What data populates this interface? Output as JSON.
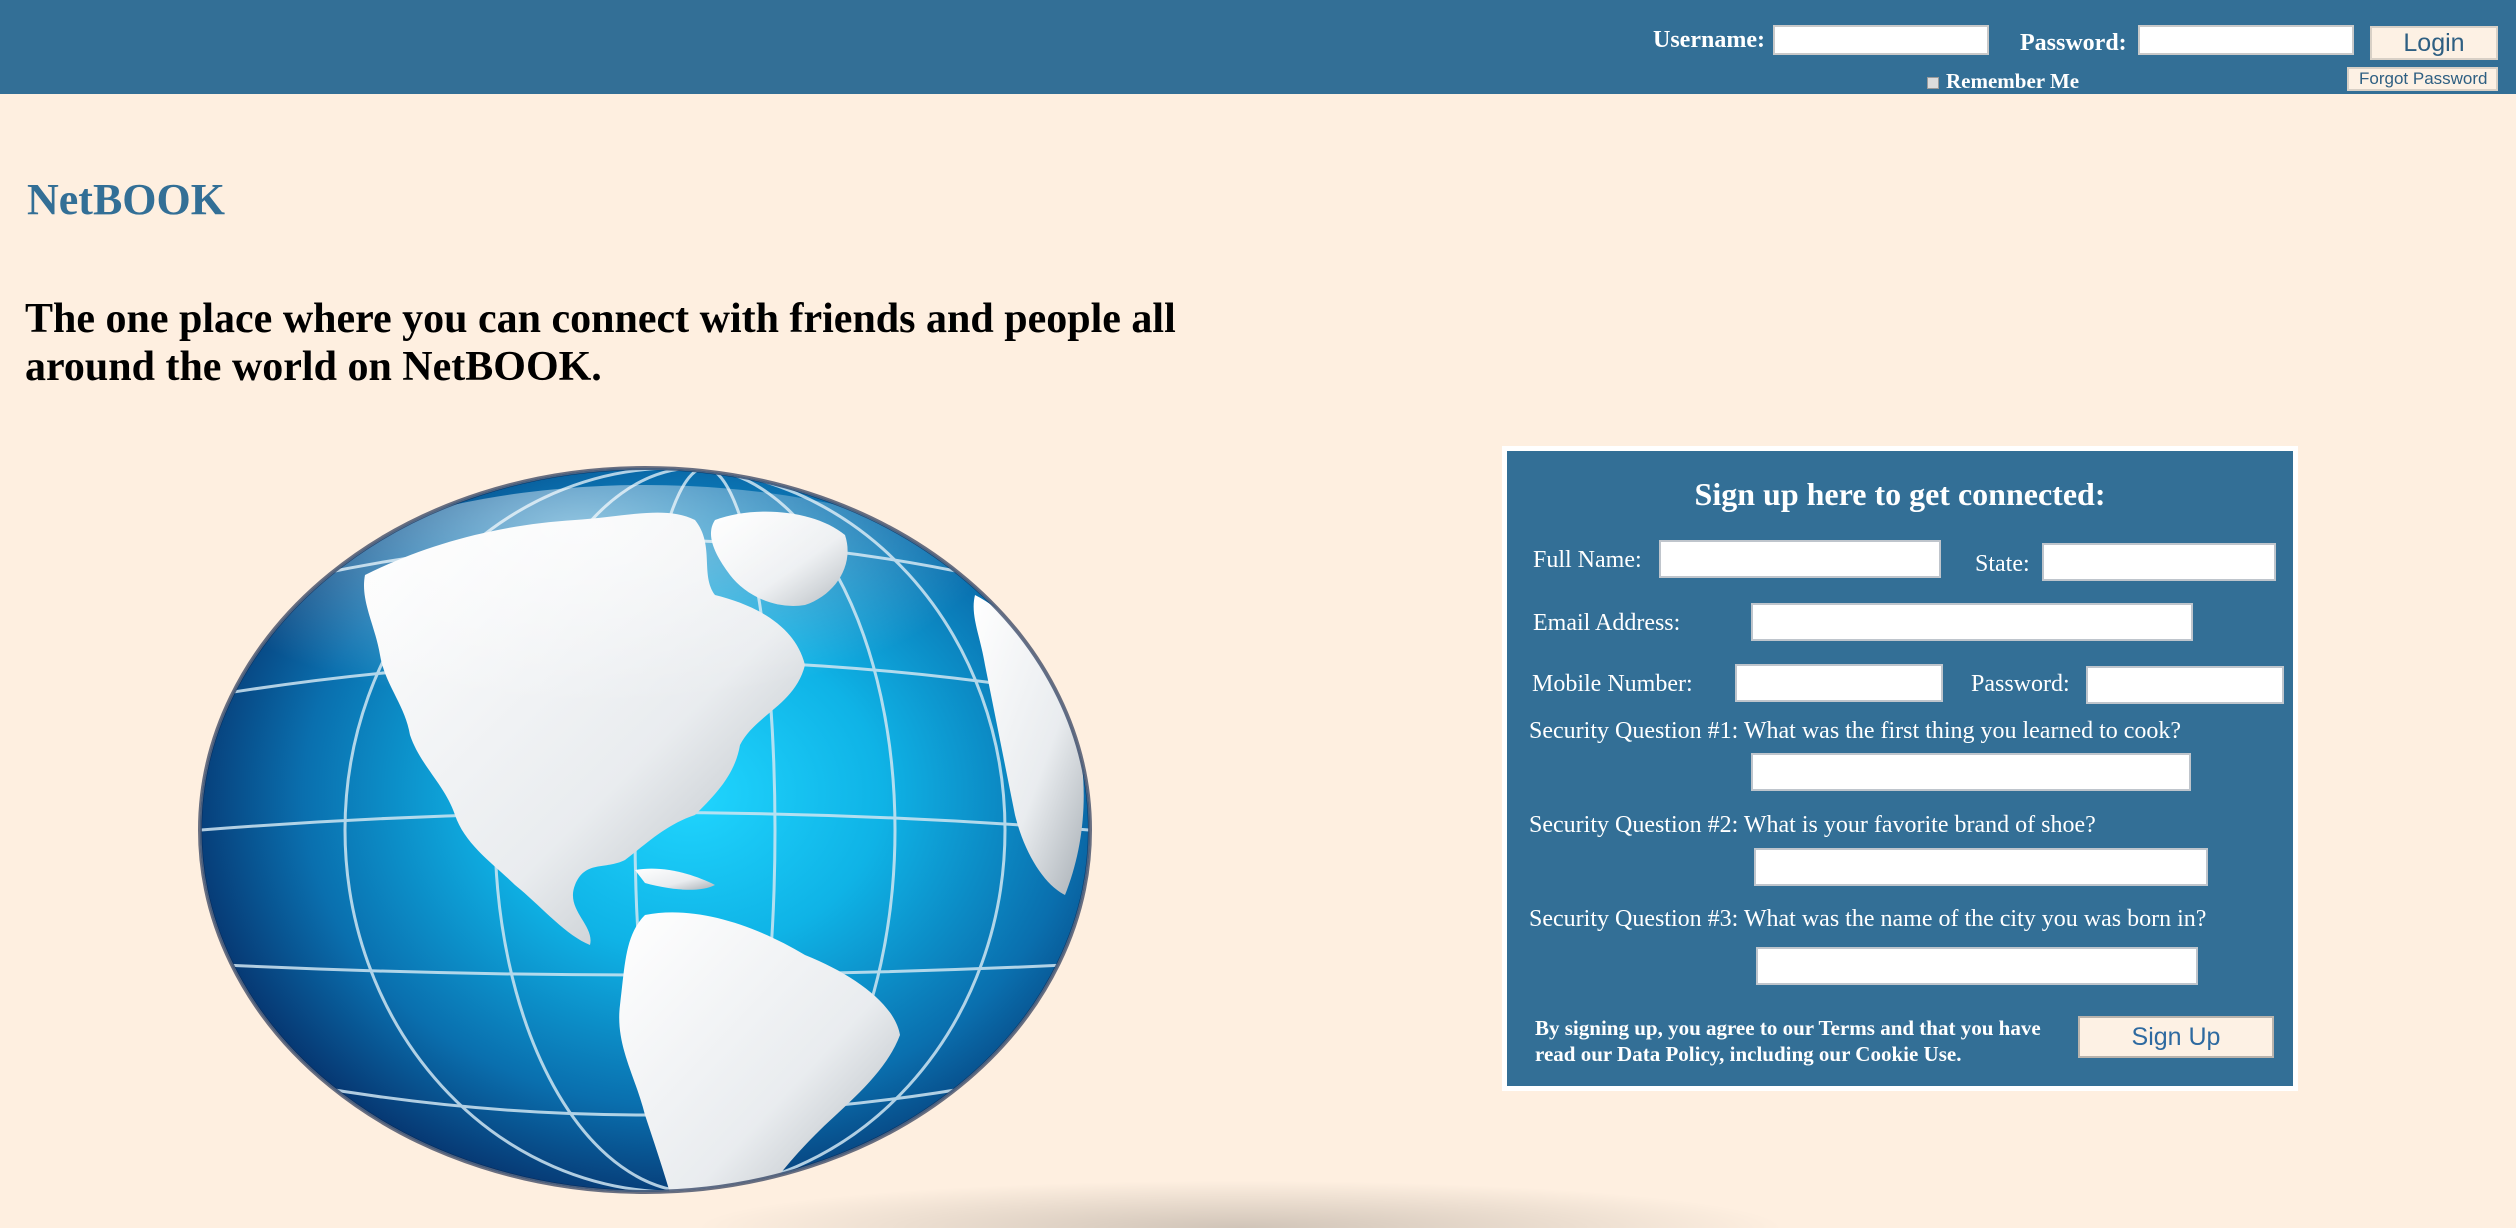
{
  "header": {
    "username_label": "Username:",
    "username_value": "",
    "password_label": "Password:",
    "password_value": "",
    "login_label": "Login",
    "remember_label": "Remember Me",
    "forgot_label": "Forgot Password"
  },
  "hero": {
    "brand": "NetBOOK",
    "tagline": "The one place where you can connect with friends and people all around the world on NetBOOK."
  },
  "signup": {
    "title": "Sign up here to get connected:",
    "full_name_label": "Full Name:",
    "state_label": "State:",
    "email_label": "Email Address:",
    "mobile_label": "Mobile Number:",
    "password_label": "Password:",
    "q1_label": "Security Question #1: What was the first thing you learned to cook?",
    "q2_label": "Security Question #2: What is your favorite brand of shoe?",
    "q3_label": "Security Question #3: What was the name of the city you was born in?",
    "terms": "By signing up, you agree to our Terms and that you have read our Data Policy, including our Cookie Use.",
    "button_label": "Sign Up"
  },
  "colors": {
    "header_bg": "#336f96",
    "page_bg": "#feefe0",
    "brand": "#336f96"
  },
  "icons": {
    "globe": "globe-icon"
  }
}
